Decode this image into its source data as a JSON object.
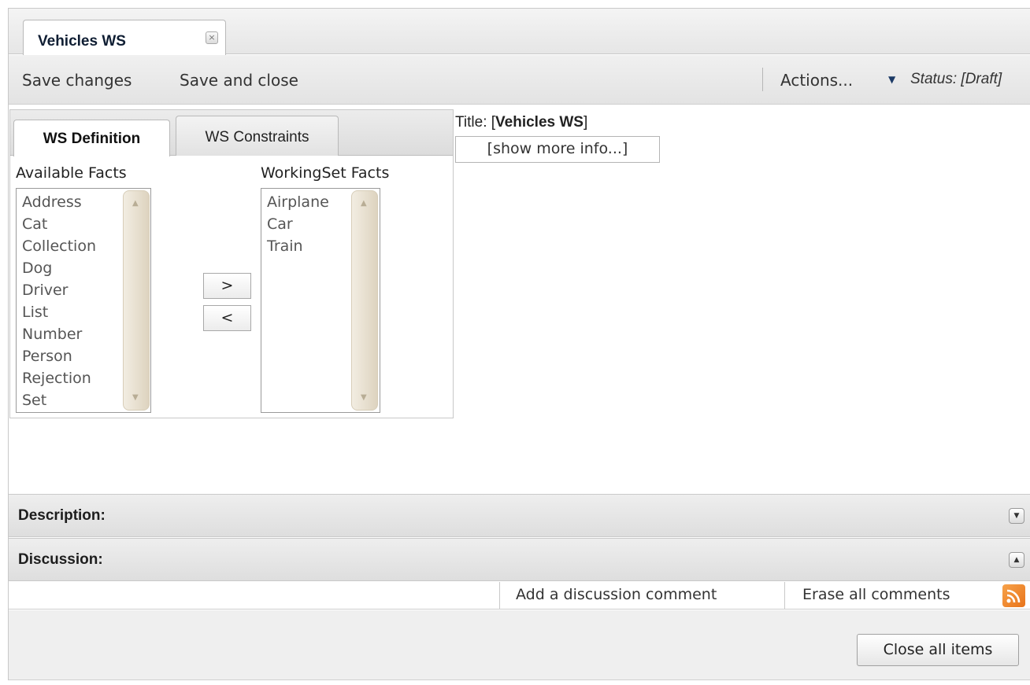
{
  "tab": {
    "title": "Vehicles WS",
    "close_symbol": "×"
  },
  "toolbar": {
    "save_label": "Save changes",
    "save_close_label": "Save and close",
    "actions_label": "Actions...",
    "actions_arrow": "▼",
    "status": "Status: [Draft]"
  },
  "inner_tabs": [
    {
      "label": "WS Definition",
      "active": true
    },
    {
      "label": "WS Constraints",
      "active": false
    }
  ],
  "available_facts": {
    "label": "Available Facts",
    "items": [
      "Address",
      "Cat",
      "Collection",
      "Dog",
      "Driver",
      "List",
      "Number",
      "Person",
      "Rejection",
      "Set"
    ]
  },
  "workingset_facts": {
    "label": "WorkingSet Facts",
    "items": [
      "Airplane",
      "Car",
      "Train"
    ]
  },
  "move_buttons": {
    "add": ">",
    "remove": "<"
  },
  "info": {
    "title_prefix": "Title: [",
    "title_value": "Vehicles WS",
    "title_suffix": "]",
    "more_info": "[show more info...]"
  },
  "sections": {
    "description": {
      "label": "Description:",
      "toggle": "▼"
    },
    "discussion": {
      "label": "Discussion:",
      "toggle": "▲"
    }
  },
  "discussion_actions": {
    "add_comment": "Add a discussion comment",
    "erase_comments": "Erase all comments",
    "rss_icon": "rss-icon"
  },
  "footer": {
    "close_all": "Close all items"
  },
  "colors": {
    "rss_orange": "#e8731a",
    "tab_title": "#0f1e33"
  }
}
